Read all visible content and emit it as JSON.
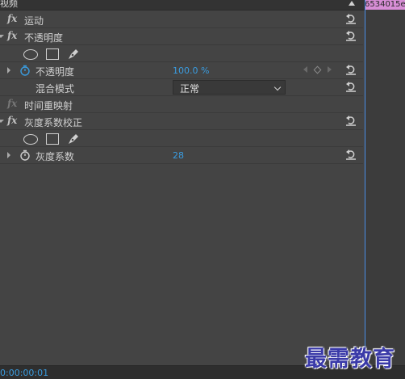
{
  "header": {
    "title": "视频"
  },
  "timeline": {
    "clip_label": "6534015e"
  },
  "effects": [
    {
      "name": "运动"
    },
    {
      "name": "不透明度"
    },
    {
      "name": "时间重映射"
    },
    {
      "name": "灰度系数校正"
    }
  ],
  "params": {
    "opacity": {
      "label": "不透明度",
      "value": "100.0 %"
    },
    "blend_mode": {
      "label": "混合模式",
      "value": "正常"
    },
    "gamma": {
      "label": "灰度系数",
      "value": "28"
    }
  },
  "footer": {
    "timecode": "0:00:00:01"
  },
  "watermark": "最需教育",
  "colors": {
    "accent": "#3a9ce0",
    "clip": "#d88ed6",
    "playhead": "#4a8ee8"
  }
}
